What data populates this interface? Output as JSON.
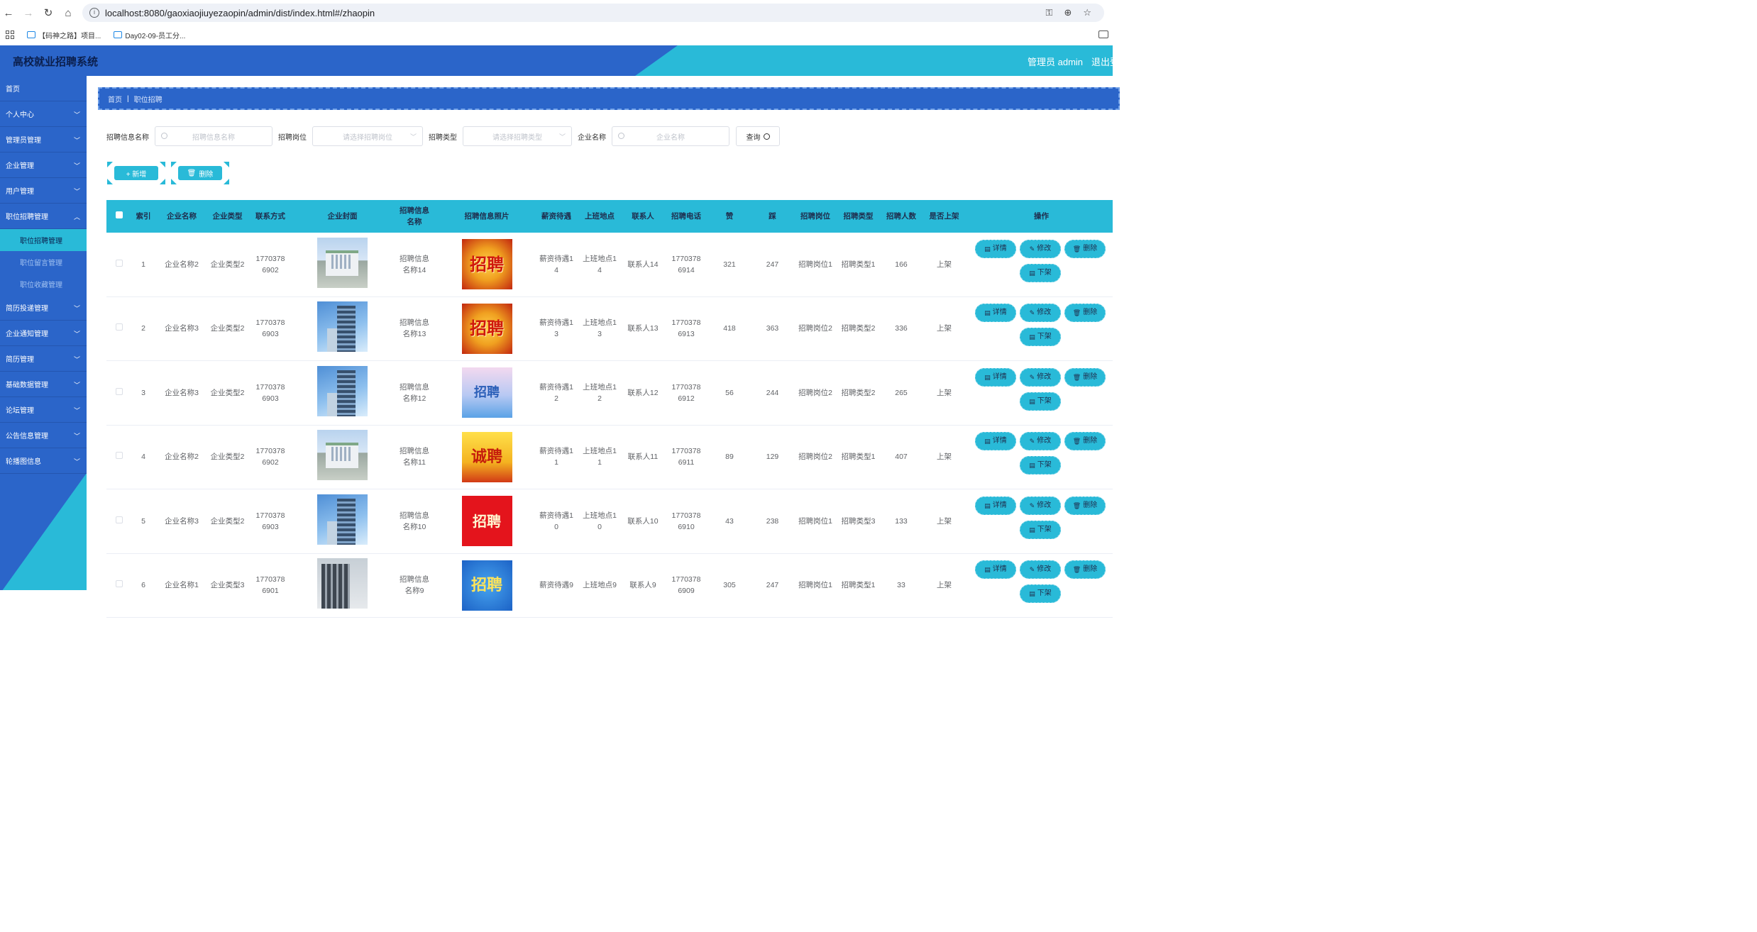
{
  "browser": {
    "url": "localhost:8080/gaoxiaojiuyezaopin/admin/dist/index.html#/zhaopin",
    "bookmarks": [
      "【码神之路】项目...",
      "Day02-09-员工分..."
    ]
  },
  "header": {
    "title": "高校就业招聘系统",
    "user": "管理员 admin",
    "logout": "退出登录"
  },
  "sidebar": {
    "items": [
      {
        "label": "首页"
      },
      {
        "label": "个人中心"
      },
      {
        "label": "管理员管理"
      },
      {
        "label": "企业管理"
      },
      {
        "label": "用户管理"
      },
      {
        "label": "职位招聘管理"
      }
    ],
    "sub_items": [
      {
        "label": "职位招聘管理",
        "active": true
      },
      {
        "label": "职位留言管理"
      },
      {
        "label": "职位收藏管理"
      }
    ],
    "items_after": [
      {
        "label": "简历投递管理"
      },
      {
        "label": "企业通知管理"
      },
      {
        "label": "简历管理"
      },
      {
        "label": "基础数据管理"
      },
      {
        "label": "论坛管理"
      },
      {
        "label": "公告信息管理"
      },
      {
        "label": "轮播图信息"
      }
    ]
  },
  "breadcrumb": {
    "home": "首页",
    "sep": "|",
    "current": "职位招聘"
  },
  "search": {
    "name_label": "招聘信息名称",
    "name_placeholder": "招聘信息名称",
    "post_label": "招聘岗位",
    "post_placeholder": "请选择招聘岗位",
    "type_label": "招聘类型",
    "type_placeholder": "请选择招聘类型",
    "company_label": "企业名称",
    "company_placeholder": "企业名称",
    "query_button": "查询"
  },
  "actions": {
    "add": "+ 新增",
    "delete": "删除"
  },
  "table": {
    "headers": [
      "索引",
      "企业名称",
      "企业类型",
      "联系方式",
      "企业封面",
      "招聘信息\n名称",
      "招聘信息照片",
      "薪资待遇",
      "上班地点",
      "联系人",
      "招聘电话",
      "赞",
      "踩",
      "招聘岗位",
      "招聘类型",
      "招聘人数",
      "是否上架",
      "操作"
    ],
    "op_labels": {
      "detail": "详情",
      "edit": "修改",
      "delete": "删除",
      "offline": "下架"
    },
    "rows": [
      {
        "idx": "1",
        "company": "企业名称2",
        "ctype": "企业类型2",
        "phone": "1770378\n6902",
        "cover": "building-a",
        "title": "招聘信息\n名称14",
        "poster": "招聘",
        "salary": "薪资待遇1\n4",
        "place": "上班地点1\n4",
        "contact": "联系人14",
        "tel": "1770378\n6914",
        "likes": "321",
        "dislikes": "247",
        "post": "招聘岗位1",
        "rtype": "招聘类型1",
        "count": "166",
        "status": "上架"
      },
      {
        "idx": "2",
        "company": "企业名称3",
        "ctype": "企业类型2",
        "phone": "1770378\n6903",
        "cover": "building-b",
        "title": "招聘信息\n名称13",
        "poster": "招聘",
        "salary": "薪资待遇1\n3",
        "place": "上班地点1\n3",
        "contact": "联系人13",
        "tel": "1770378\n6913",
        "likes": "418",
        "dislikes": "363",
        "post": "招聘岗位2",
        "rtype": "招聘类型2",
        "count": "336",
        "status": "上架"
      },
      {
        "idx": "3",
        "company": "企业名称3",
        "ctype": "企业类型2",
        "phone": "1770378\n6903",
        "cover": "building-b",
        "title": "招聘信息\n名称12",
        "poster": "招聘",
        "salary": "薪资待遇1\n2",
        "place": "上班地点1\n2",
        "contact": "联系人12",
        "tel": "1770378\n6912",
        "likes": "56",
        "dislikes": "244",
        "post": "招聘岗位2",
        "rtype": "招聘类型2",
        "count": "265",
        "status": "上架"
      },
      {
        "idx": "4",
        "company": "企业名称2",
        "ctype": "企业类型2",
        "phone": "1770378\n6902",
        "cover": "building-a",
        "title": "招聘信息\n名称11",
        "poster": "诚聘",
        "salary": "薪资待遇1\n1",
        "place": "上班地点1\n1",
        "contact": "联系人11",
        "tel": "1770378\n6911",
        "likes": "89",
        "dislikes": "129",
        "post": "招聘岗位2",
        "rtype": "招聘类型1",
        "count": "407",
        "status": "上架"
      },
      {
        "idx": "5",
        "company": "企业名称3",
        "ctype": "企业类型2",
        "phone": "1770378\n6903",
        "cover": "building-b",
        "title": "招聘信息\n名称10",
        "poster": "招聘",
        "salary": "薪资待遇1\n0",
        "place": "上班地点1\n0",
        "contact": "联系人10",
        "tel": "1770378\n6910",
        "likes": "43",
        "dislikes": "238",
        "post": "招聘岗位1",
        "rtype": "招聘类型3",
        "count": "133",
        "status": "上架"
      },
      {
        "idx": "6",
        "company": "企业名称1",
        "ctype": "企业类型3",
        "phone": "1770378\n6901",
        "cover": "building-c",
        "title": "招聘信息\n名称9",
        "poster": "招聘",
        "salary": "薪资待遇9",
        "place": "上班地点9",
        "contact": "联系人9",
        "tel": "1770378\n6909",
        "likes": "305",
        "dislikes": "247",
        "post": "招聘岗位1",
        "rtype": "招聘类型1",
        "count": "33",
        "status": "上架"
      }
    ]
  },
  "colors": {
    "primary_blue": "#2b65c9",
    "accent_cyan": "#29bad8"
  }
}
